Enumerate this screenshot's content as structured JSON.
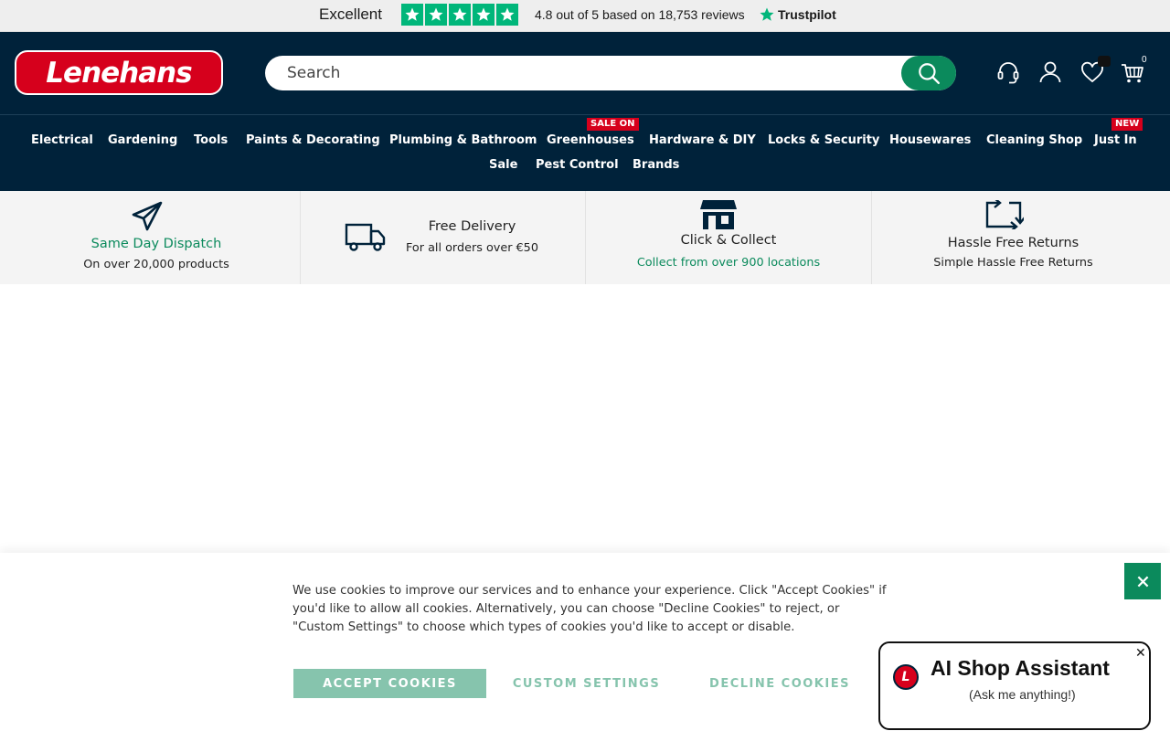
{
  "trustpilot": {
    "excellent": "Excellent",
    "rating_text": "4.8 out of 5 based on 18,753 reviews",
    "brand": "Trustpilot",
    "star_color": "#00b67a"
  },
  "header": {
    "logo_text": "Lenehans",
    "search_placeholder": "Search",
    "cart_count": "0",
    "icons": [
      "headset-icon",
      "user-icon",
      "heart-icon",
      "cart-icon"
    ],
    "brand_color": "#00223a",
    "accent_color": "#0b8a5c"
  },
  "nav": {
    "items": [
      {
        "label": "Electrical"
      },
      {
        "label": "Gardening"
      },
      {
        "label": "Tools"
      },
      {
        "label": "Paints & Decorating"
      },
      {
        "label": "Plumbing & Bathroom"
      },
      {
        "label": "Greenhouses",
        "badge": "SALE ON"
      },
      {
        "label": "Hardware & DIY"
      },
      {
        "label": "Locks & Security"
      },
      {
        "label": "Housewares"
      },
      {
        "label": "Cleaning Shop"
      },
      {
        "label": "Just In",
        "badge": "NEW"
      },
      {
        "label": "Sale"
      },
      {
        "label": "Pest Control"
      },
      {
        "label": "Brands"
      }
    ]
  },
  "usps": [
    {
      "icon": "paper-plane-icon",
      "title": "Same Day Dispatch",
      "subtitle": "On over 20,000 products"
    },
    {
      "icon": "delivery-truck-icon",
      "title": "Free Delivery",
      "subtitle": "For all orders over €50"
    },
    {
      "icon": "store-icon",
      "title": "Click & Collect",
      "subtitle": "Collect from over 900 locations"
    },
    {
      "icon": "returns-icon",
      "title": "Hassle Free Returns",
      "subtitle": "Simple Hassle Free Returns"
    }
  ],
  "cookie": {
    "message": "We use cookies to improve our services and to enhance your experience. Click \"Accept Cookies\" if you'd like to allow all cookies. Alternatively, you can choose \"Decline Cookies\" to reject, or \"Custom Settings\" to choose which types of cookies you'd like to accept or disable.",
    "accept_label": "ACCEPT COOKIES",
    "custom_label": "CUSTOM SETTINGS",
    "decline_label": "DECLINE COOKIES"
  },
  "assistant": {
    "logo_letter": "L",
    "title": "AI Shop Assistant",
    "subtitle": "(Ask me anything!)",
    "close": "✕"
  }
}
